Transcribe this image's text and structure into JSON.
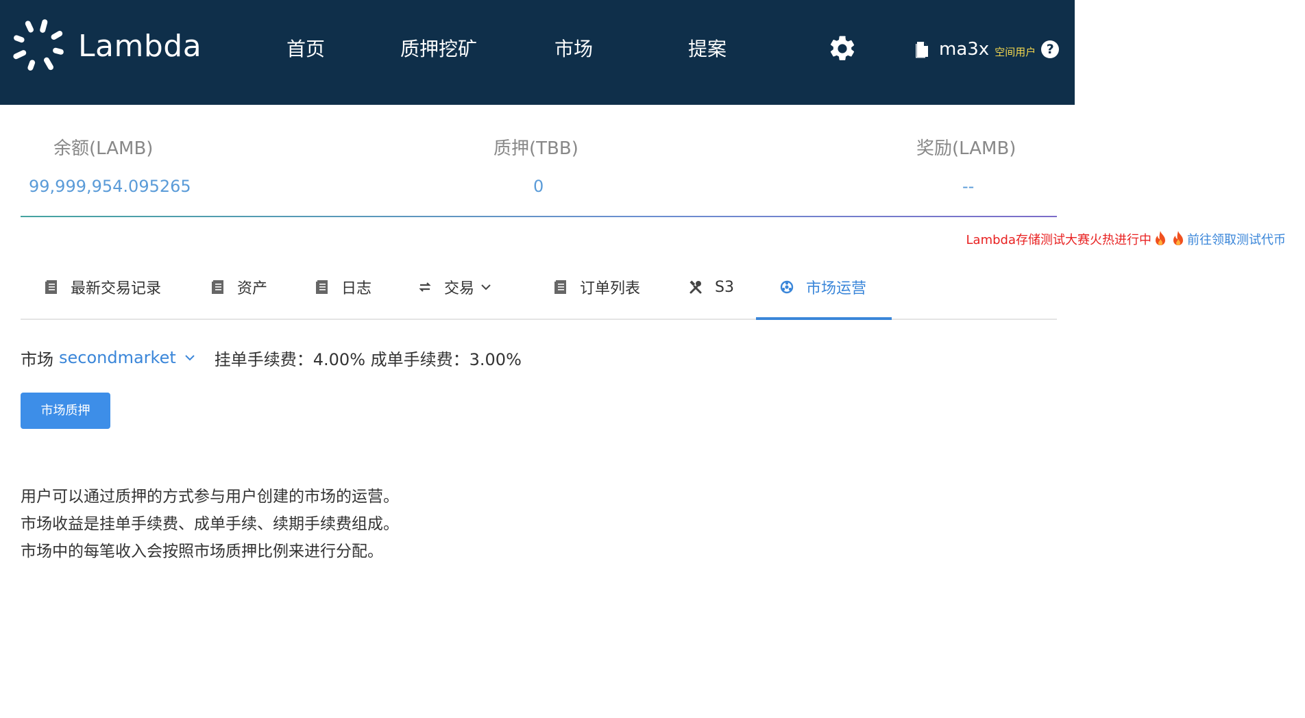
{
  "header": {
    "logo_text": "Lambda",
    "nav": [
      {
        "label": "首页"
      },
      {
        "label": "质押挖矿"
      },
      {
        "label": "市场"
      },
      {
        "label": "提案"
      }
    ],
    "user": {
      "name": "ma3x",
      "role": "空间用户",
      "help": "?"
    },
    "colors": {
      "background": "#0f2f4a",
      "role": "#f5d84e"
    }
  },
  "stats": [
    {
      "label": "余额(LAMB)",
      "value": "99,999,954.095265"
    },
    {
      "label": "质押(TBB)",
      "value": "0"
    },
    {
      "label": "奖励(LAMB)",
      "value": "--"
    }
  ],
  "promo": {
    "hot_text": "Lambda存储测试大赛火热进行中",
    "link_text": "前往领取测试代币"
  },
  "tabs": [
    {
      "label": "最新交易记录",
      "icon": "document-icon"
    },
    {
      "label": "资产",
      "icon": "document-icon"
    },
    {
      "label": "日志",
      "icon": "document-icon"
    },
    {
      "label": "交易",
      "icon": "exchange-icon"
    },
    {
      "label": "订单列表",
      "icon": "document-icon"
    },
    {
      "label": "S3",
      "icon": "tools-icon"
    },
    {
      "label": "市场运营",
      "icon": "gear-network-icon",
      "active": true
    }
  ],
  "market": {
    "label": "市场",
    "selected": "secondmarket",
    "fees": "挂单手续费：4.00% 成单手续费：3.00%"
  },
  "stake_button": "市场质押",
  "description": [
    "用户可以通过质押的方式参与用户创建的市场的运营。",
    "市场收益是挂单手续费、成单手续、续期手续费组成。",
    "市场中的每笔收入会按照市场质押比例来进行分配。"
  ],
  "accent_color": "#3a86d9"
}
